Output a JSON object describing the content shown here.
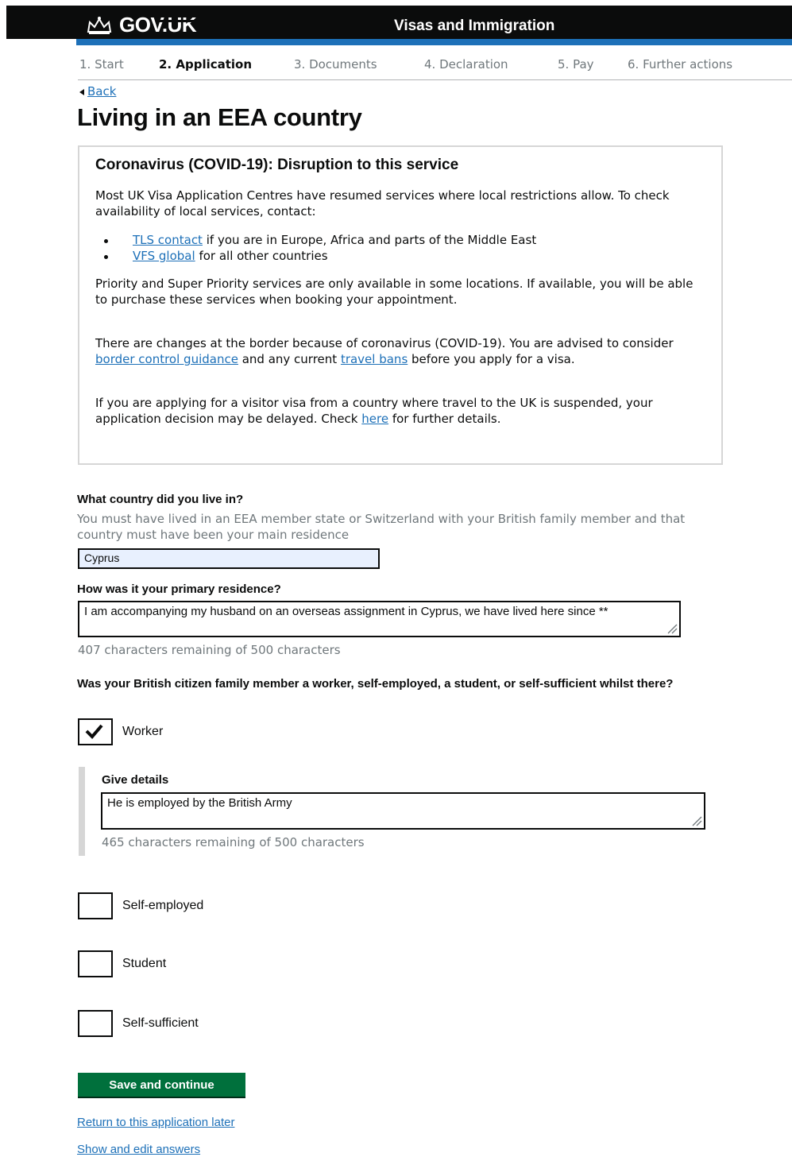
{
  "header": {
    "logo_text": "GOV.UK",
    "service_name": "Visas and Immigration",
    "colors": {
      "bar": "#0b0c0c",
      "accent": "#1d70b8"
    }
  },
  "steps": [
    {
      "label": "1. Start"
    },
    {
      "label": "2. Application",
      "active": true
    },
    {
      "label": "3. Documents"
    },
    {
      "label": "4. Declaration"
    },
    {
      "label": "5. Pay"
    },
    {
      "label": "6. Further actions"
    }
  ],
  "back_label": "Back",
  "page_title": "Living in an EEA country",
  "notice": {
    "title": "Coronavirus (COVID-19): Disruption to this service",
    "p1": "Most UK Visa Application Centres have resumed services where local restrictions allow. To check availability of local services, contact:",
    "bullet1_link": "TLS contact",
    "bullet1_text": " if you are in Europe, Africa and parts of the Middle East",
    "bullet2_link": "VFS global",
    "bullet2_text": " for all other countries",
    "p2": "Priority and Super Priority services are only available in some locations. If available, you will be able to purchase these services when booking your appointment.",
    "p3_a": "There are changes at the border because of coronavirus (COVID-19). You are advised to consider ",
    "p3_link1": "border control guidance",
    "p3_b": " and any current ",
    "p3_link2": "travel bans",
    "p3_c": " before you apply for a visa.",
    "p4_a": "If you are applying for a visitor visa from a country where travel to the UK is suspended, your application decision may be delayed. Check ",
    "p4_link": "here",
    "p4_b": " for further details."
  },
  "country": {
    "label": "What country did you live in?",
    "hint": "You must have lived in an EEA member state or Switzerland with your British family member and that country must have been your main residence",
    "value": "Cyprus"
  },
  "residence": {
    "label": "How was it your primary residence?",
    "value": "I am accompanying my husband on an overseas assignment in Cyprus, we have lived here since **",
    "count": "407 characters remaining of 500 characters"
  },
  "status_question": "Was your British citizen family member a worker, self-employed, a student, or self-sufficient whilst there?",
  "options": {
    "worker": {
      "label": "Worker",
      "checked": true
    },
    "self_employed": {
      "label": "Self-employed",
      "checked": false
    },
    "student": {
      "label": "Student",
      "checked": false
    },
    "self_sufficient": {
      "label": "Self-sufficient",
      "checked": false
    }
  },
  "details": {
    "label": "Give details",
    "value": "He is employed by the British Army",
    "count": "465 characters remaining of 500 characters"
  },
  "actions": {
    "save_label": "Save and continue",
    "return_label": "Return to this application later",
    "show_label": "Show and edit answers",
    "button_color": "#00703c"
  }
}
